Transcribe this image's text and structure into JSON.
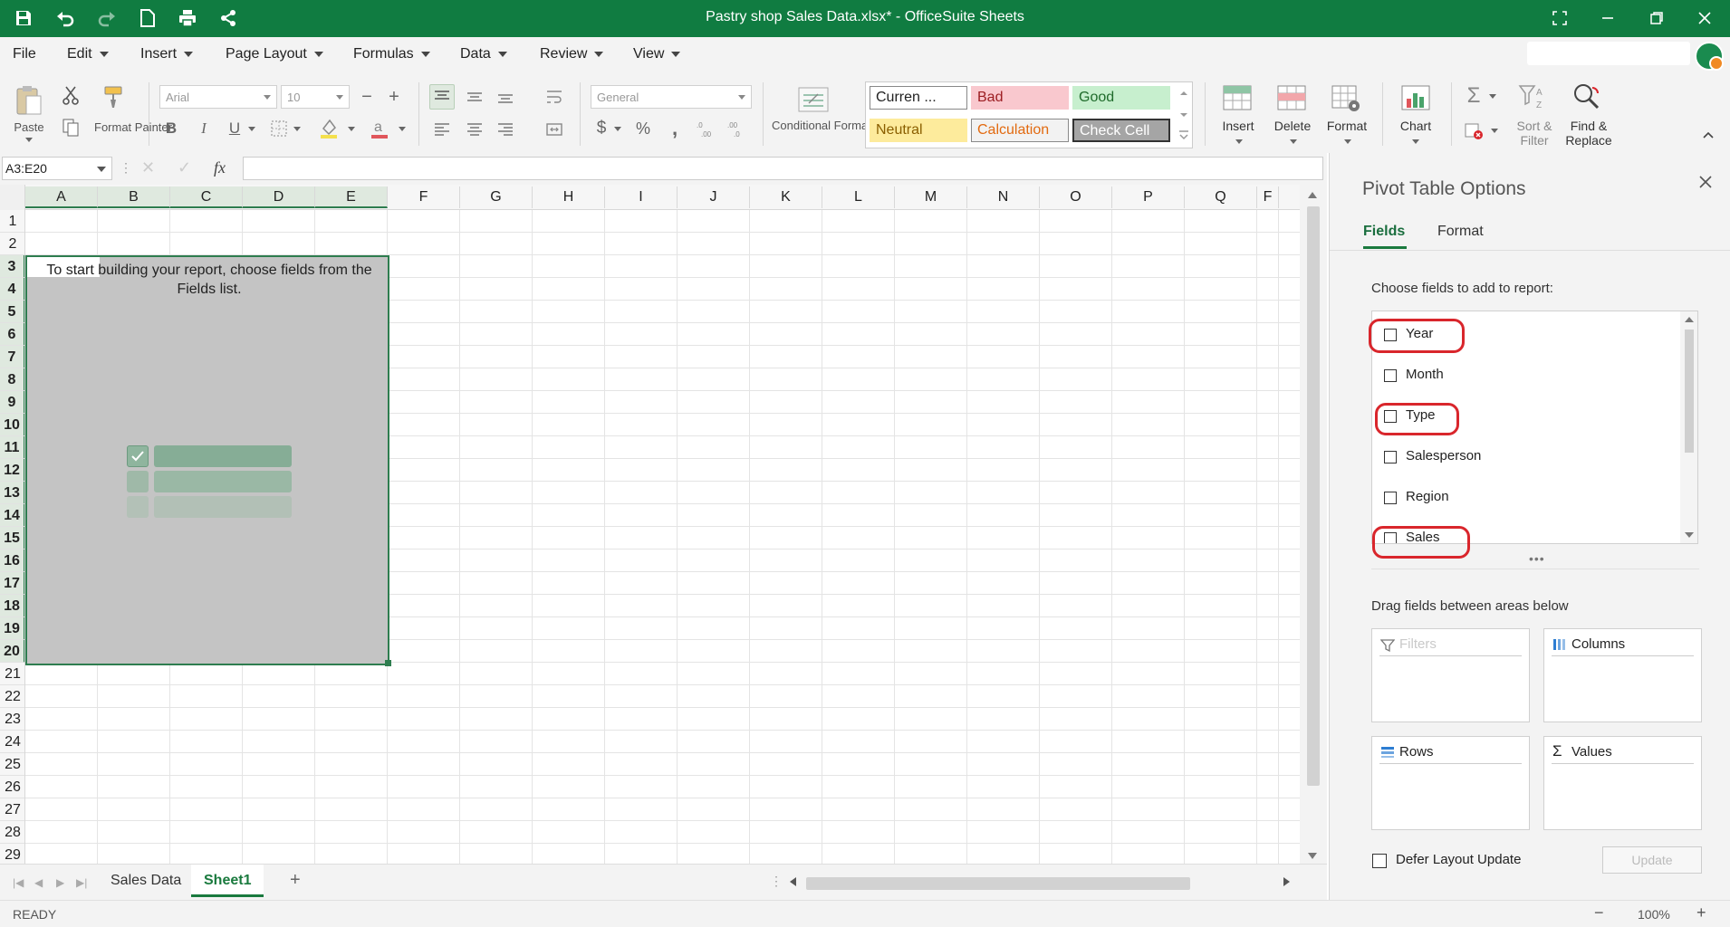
{
  "window": {
    "title": "Pastry shop Sales Data.xlsx* - OfficeSuite Sheets"
  },
  "menu": {
    "items": [
      {
        "label": "File"
      },
      {
        "label": "Edit"
      },
      {
        "label": "Insert"
      },
      {
        "label": "Page Layout"
      },
      {
        "label": "Formulas"
      },
      {
        "label": "Data"
      },
      {
        "label": "Review"
      },
      {
        "label": "View"
      }
    ]
  },
  "ribbon": {
    "paste": "Paste",
    "format_painter": "Format Painter",
    "font_name": "Arial",
    "font_size": "10",
    "bold": "B",
    "italic": "I",
    "underline": "U",
    "number_format": "General",
    "conditional_formatting": "Conditional Formatting",
    "currency_symbol": "$",
    "percent_symbol": "%",
    "comma_symbol": ",",
    "styles": {
      "currency": "Curren ...",
      "bad": "Bad",
      "good": "Good",
      "neutral": "Neutral",
      "calculation": "Calculation",
      "check_cell": "Check Cell"
    },
    "insert": "Insert",
    "delete": "Delete",
    "format": "Format",
    "chart": "Chart",
    "sort_filter": "Sort & Filter",
    "find_replace": "Find & Replace"
  },
  "formula_bar": {
    "name_box": "A3:E20",
    "fx": "fx",
    "value": ""
  },
  "grid": {
    "columns": [
      "A",
      "B",
      "C",
      "D",
      "E",
      "F",
      "G",
      "H",
      "I",
      "J",
      "K",
      "L",
      "M",
      "N",
      "O",
      "P",
      "Q",
      "F"
    ],
    "rows": [
      "1",
      "2",
      "3",
      "4",
      "5",
      "6",
      "7",
      "8",
      "9",
      "10",
      "11",
      "12",
      "13",
      "14",
      "15",
      "16",
      "17",
      "18",
      "19",
      "20",
      "21",
      "22",
      "23",
      "24",
      "25",
      "26",
      "27",
      "28",
      "29"
    ],
    "pivot_message": "To start building your report, choose fields from the Fields list."
  },
  "sheets": {
    "tabs": [
      {
        "label": "Sales Data"
      },
      {
        "label": "Sheet1"
      }
    ],
    "add": "+"
  },
  "status": {
    "state": "READY",
    "zoom": "100%",
    "zoom_out": "−",
    "zoom_in": "+"
  },
  "panel": {
    "title": "Pivot Table Options",
    "tabs": [
      {
        "label": "Fields"
      },
      {
        "label": "Format"
      }
    ],
    "choose_label": "Choose fields to add to report:",
    "fields": [
      {
        "label": "Year",
        "highlighted": true
      },
      {
        "label": "Month",
        "highlighted": false
      },
      {
        "label": "Type",
        "highlighted": true
      },
      {
        "label": "Salesperson",
        "highlighted": false
      },
      {
        "label": "Region",
        "highlighted": false
      },
      {
        "label": "Sales",
        "highlighted": true
      }
    ],
    "drag_label": "Drag fields between areas below",
    "areas": {
      "filters": "Filters",
      "columns": "Columns",
      "rows": "Rows",
      "values": "Values"
    },
    "defer_label": "Defer Layout Update",
    "update_button": "Update"
  },
  "colors": {
    "brand_green": "#107c41",
    "highlight_red": "#d9262c",
    "pivot_area": "#c4c4c4"
  }
}
